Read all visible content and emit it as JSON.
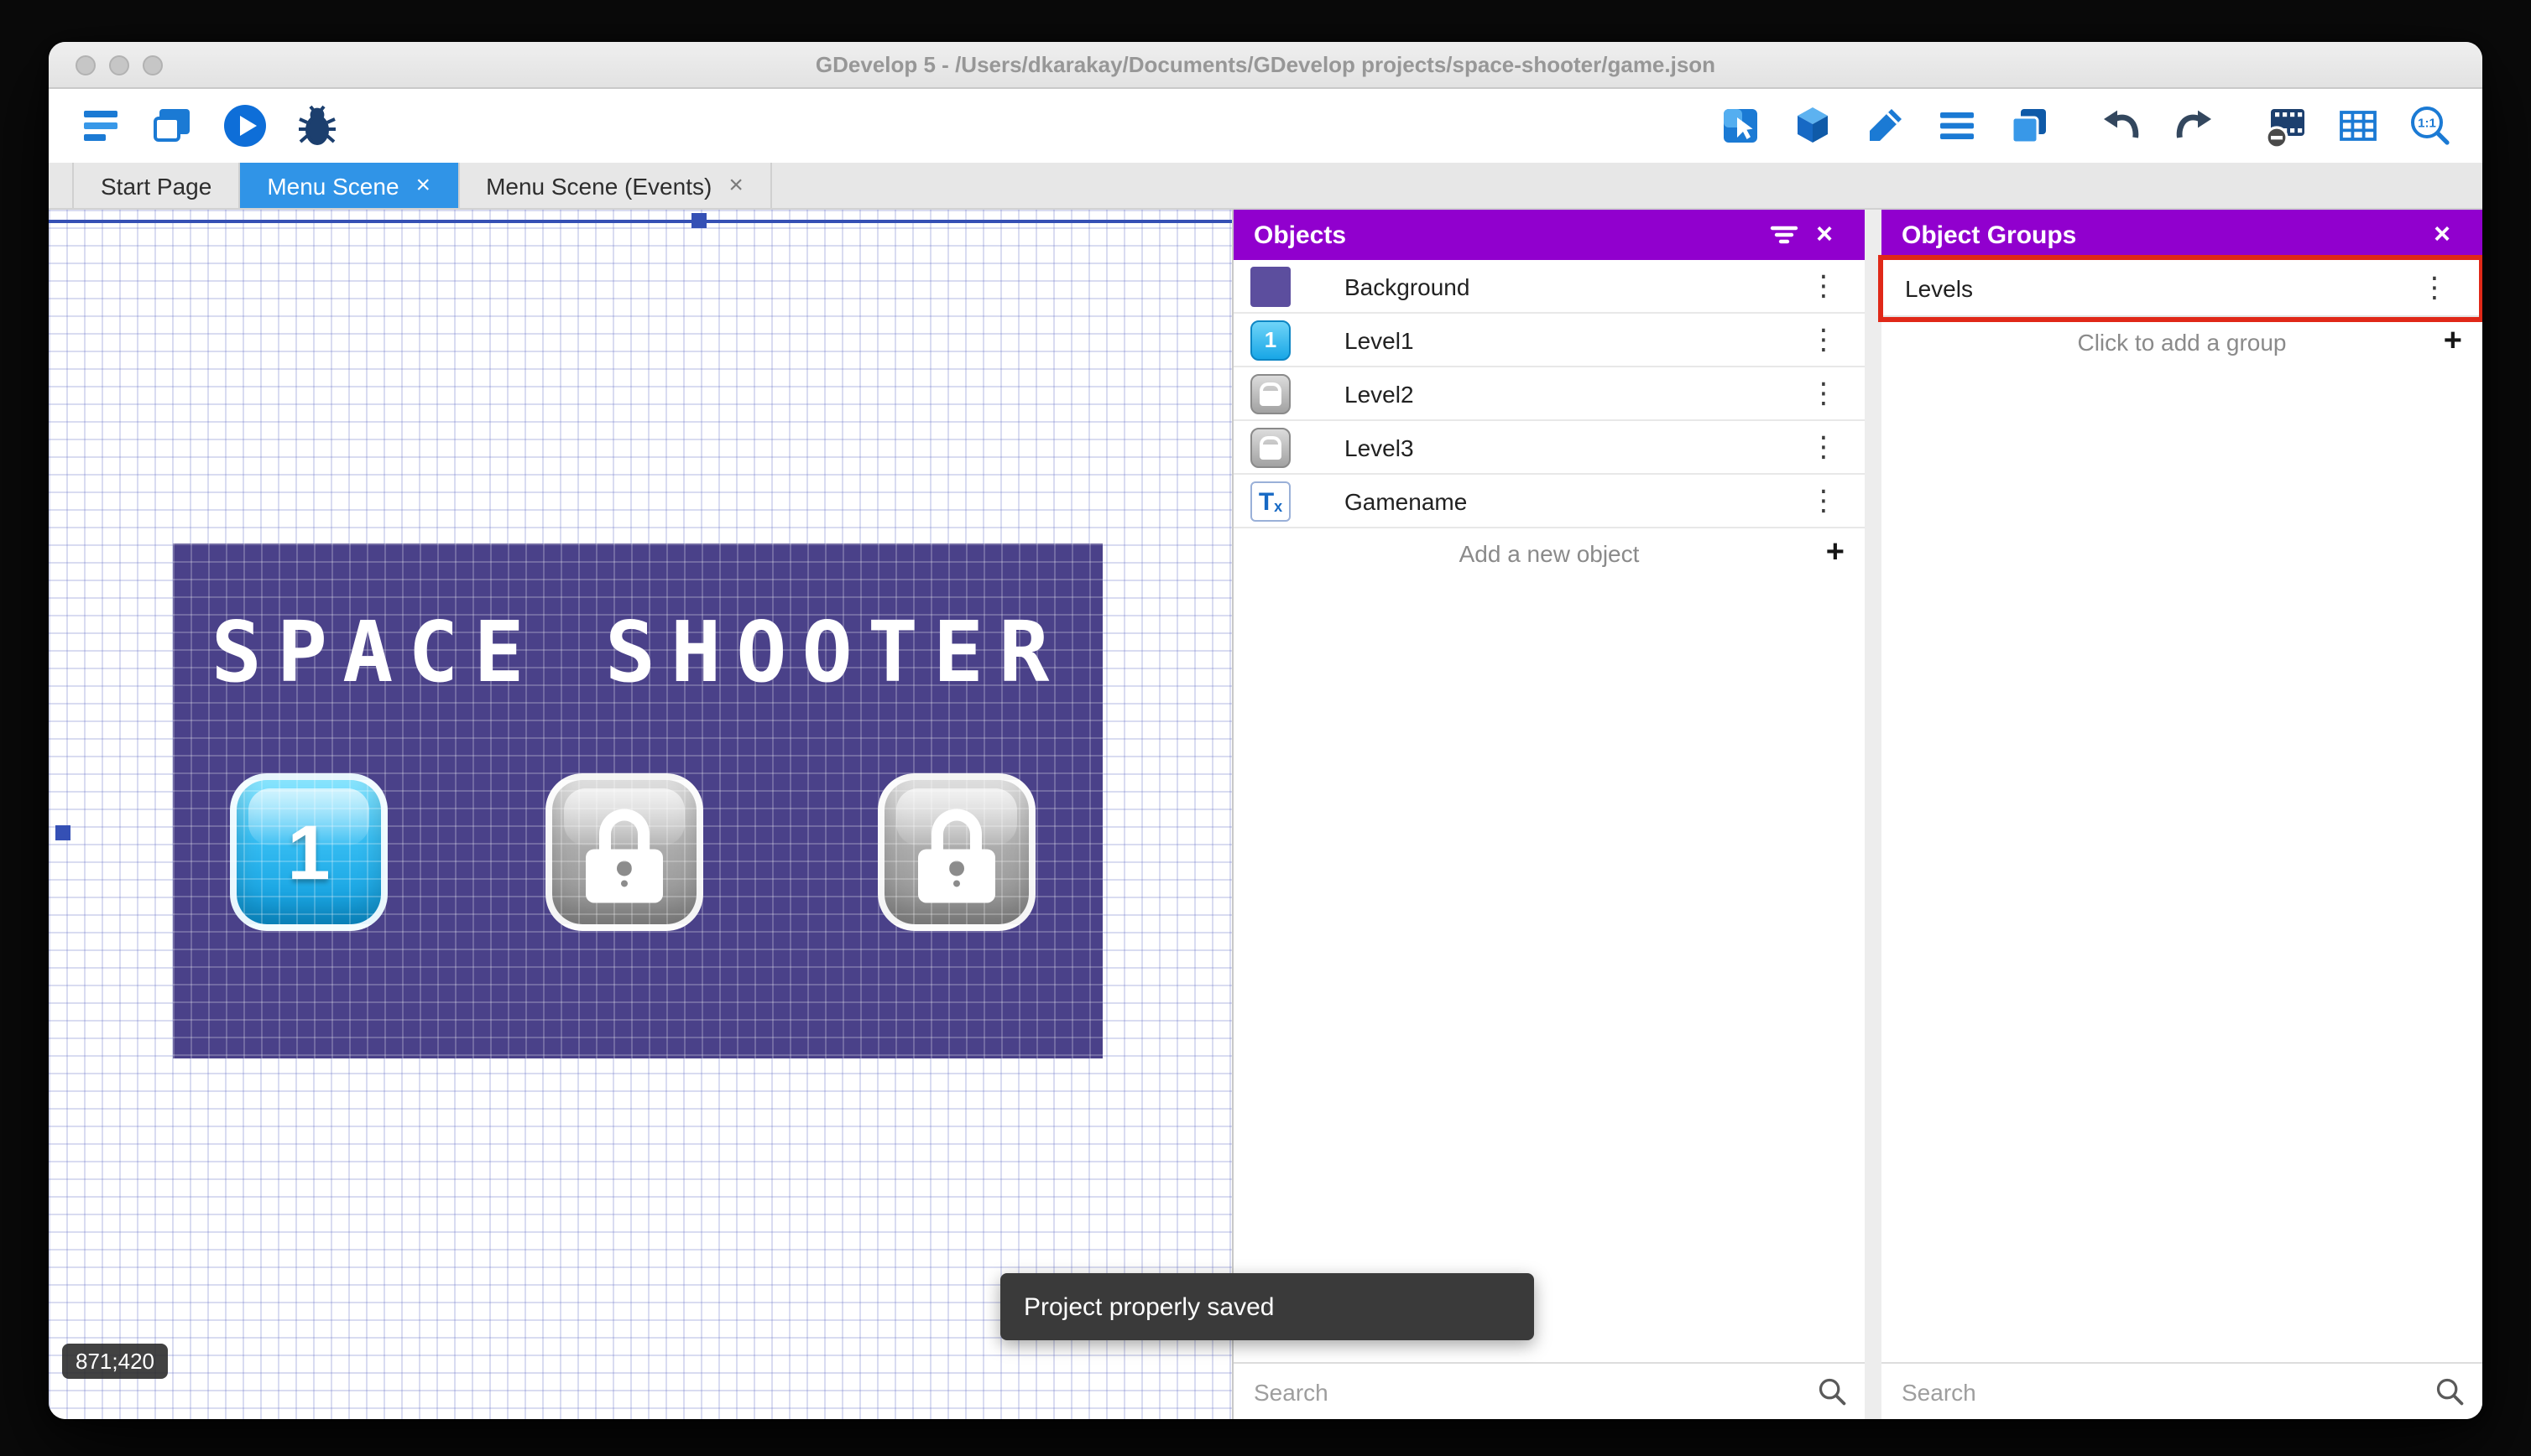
{
  "window": {
    "title": "GDevelop 5 - /Users/dkarakay/Documents/GDevelop projects/space-shooter/game.json",
    "traffic_lights": [
      "close",
      "minimize",
      "zoom"
    ]
  },
  "toolbar": {
    "left_icons": [
      "project-manager-icon",
      "scene-window-icon",
      "preview-play-icon",
      "debug-icon"
    ],
    "right_icons": [
      "objects-panel-icon",
      "object-groups-icon",
      "properties-pencil-icon",
      "instances-list-icon",
      "layers-icon",
      "undo-icon",
      "redo-icon",
      "mask-frame-icon",
      "grid-icon",
      "zoom-1-1-icon"
    ]
  },
  "tabs": [
    {
      "label": "Start Page",
      "active": false,
      "closable": false
    },
    {
      "label": "Menu Scene",
      "active": true,
      "closable": true
    },
    {
      "label": "Menu Scene (Events)",
      "active": false,
      "closable": true
    }
  ],
  "canvas": {
    "coordinates_badge": "871;420",
    "scene_preview": {
      "title": "SPACE SHOOTER",
      "level_buttons": [
        {
          "label": "1",
          "state": "unlocked"
        },
        {
          "label": "",
          "state": "locked"
        },
        {
          "label": "",
          "state": "locked"
        }
      ]
    }
  },
  "toast": {
    "message": "Project properly saved"
  },
  "objects_panel": {
    "title": "Objects",
    "items": [
      {
        "name": "Background",
        "icon": "background-thumbnail"
      },
      {
        "name": "Level1",
        "icon": "level1-thumbnail"
      },
      {
        "name": "Level2",
        "icon": "lock-thumbnail"
      },
      {
        "name": "Level3",
        "icon": "lock-thumbnail"
      },
      {
        "name": "Gamename",
        "icon": "text-thumbnail"
      }
    ],
    "add_label": "Add a new object",
    "search_placeholder": "Search"
  },
  "object_groups_panel": {
    "title": "Object Groups",
    "groups": [
      {
        "name": "Levels",
        "highlighted": true
      }
    ],
    "add_label": "Click to add a group",
    "search_placeholder": "Search"
  },
  "colors": {
    "panel_header_purple": "#9100ce",
    "active_tab_blue": "#3094e7",
    "annotation_red": "#e02818",
    "toast_bg": "#3a3a3a",
    "preview_bg": "#4a4189",
    "scene_frame_blue": "#3550b5"
  }
}
